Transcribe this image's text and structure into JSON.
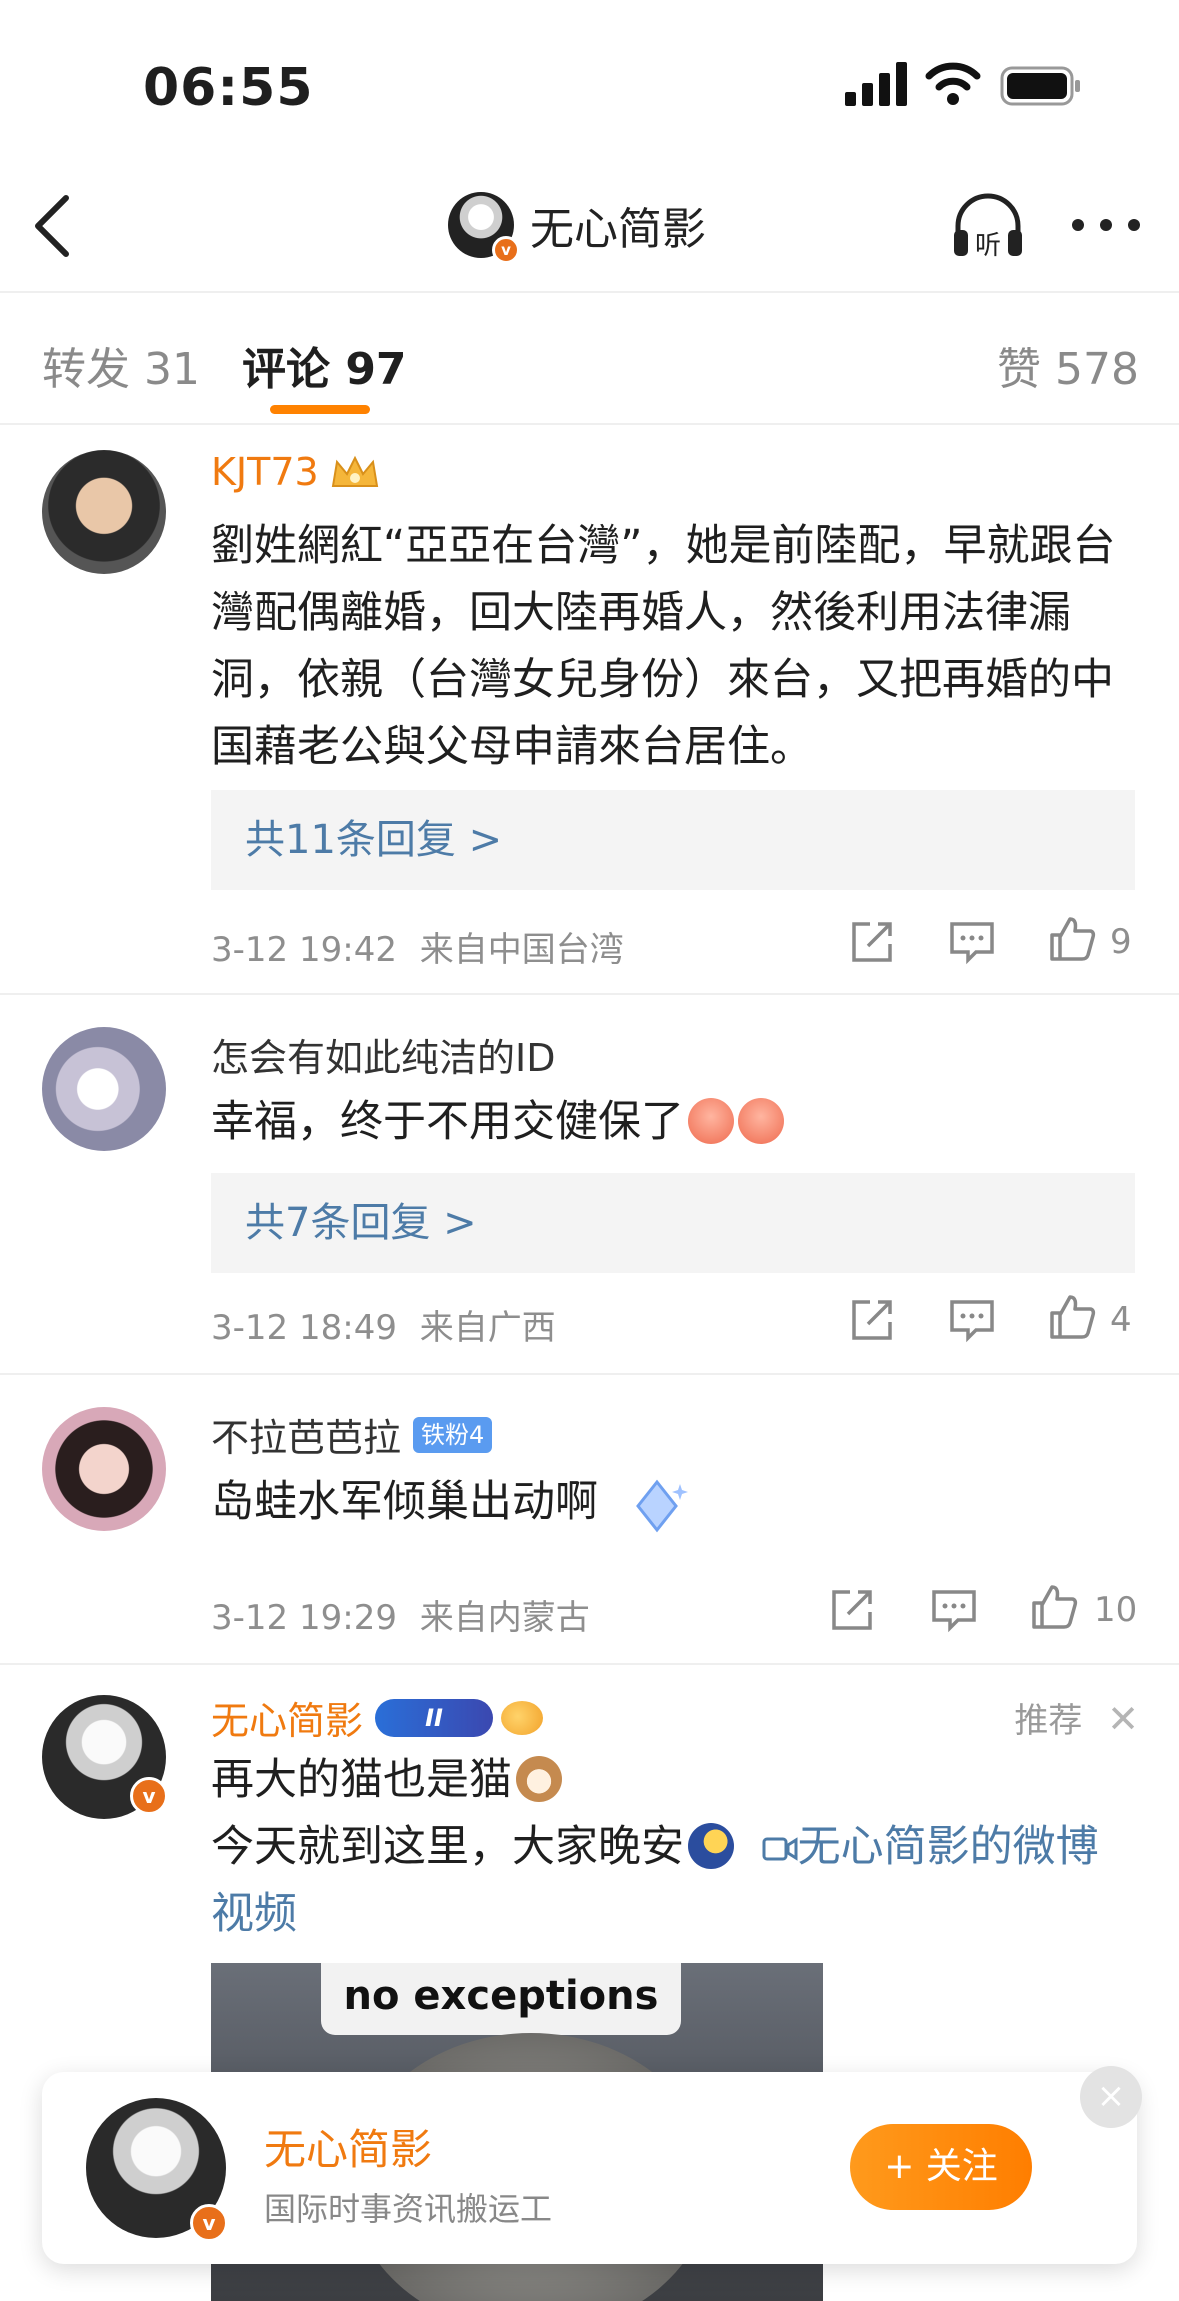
{
  "status_bar": {
    "time": "06:55"
  },
  "header": {
    "title": "无心简影",
    "verified_mark": "v",
    "icons": {
      "back": "chevron-left-icon",
      "listen": "headphones-listen-icon",
      "more": "more-dots-icon"
    },
    "listen_label": "听"
  },
  "tabs": {
    "repost": "转发 31",
    "comments": "评论 97",
    "likes": "赞 578",
    "accent_color": "#ff8200"
  },
  "comments": [
    {
      "name": "KJT73",
      "text": "劉姓網紅“亞亞在台灣”，她是前陸配，早就跟台灣配偶離婚，回大陸再婚人，然後利用法律漏洞，依親（台灣女兒身份）來台，又把再婚的中国藉老公與父母申請來台居住。",
      "replies": "共11条回复 >",
      "time": "3-12 19:42",
      "location": "来自中国台湾",
      "likes": "9"
    },
    {
      "name": "怎会有如此纯洁的ID",
      "text": "幸福，终于不用交健保了",
      "replies": "共7条回复 >",
      "time": "3-12 18:49",
      "location": "来自广西",
      "likes": "4"
    },
    {
      "name": "不拉芭芭拉",
      "badge": "铁粉4",
      "text": "岛蛙水军倾巢出动啊",
      "time": "3-12 19:29",
      "location": "来自内蒙古",
      "likes": "10"
    },
    {
      "name": "无心简影",
      "badge": "II",
      "recommend": "推荐",
      "line1": "再大的猫也是猫",
      "line2": "今天就到这里，大家晚安",
      "video_link": "无心简影的微博视频",
      "video_caption": "no exceptions"
    }
  ],
  "follow_card": {
    "name": "无心简影",
    "description": "国际时事资讯搬运工",
    "follow_label": "+ 关注",
    "close": "×"
  }
}
